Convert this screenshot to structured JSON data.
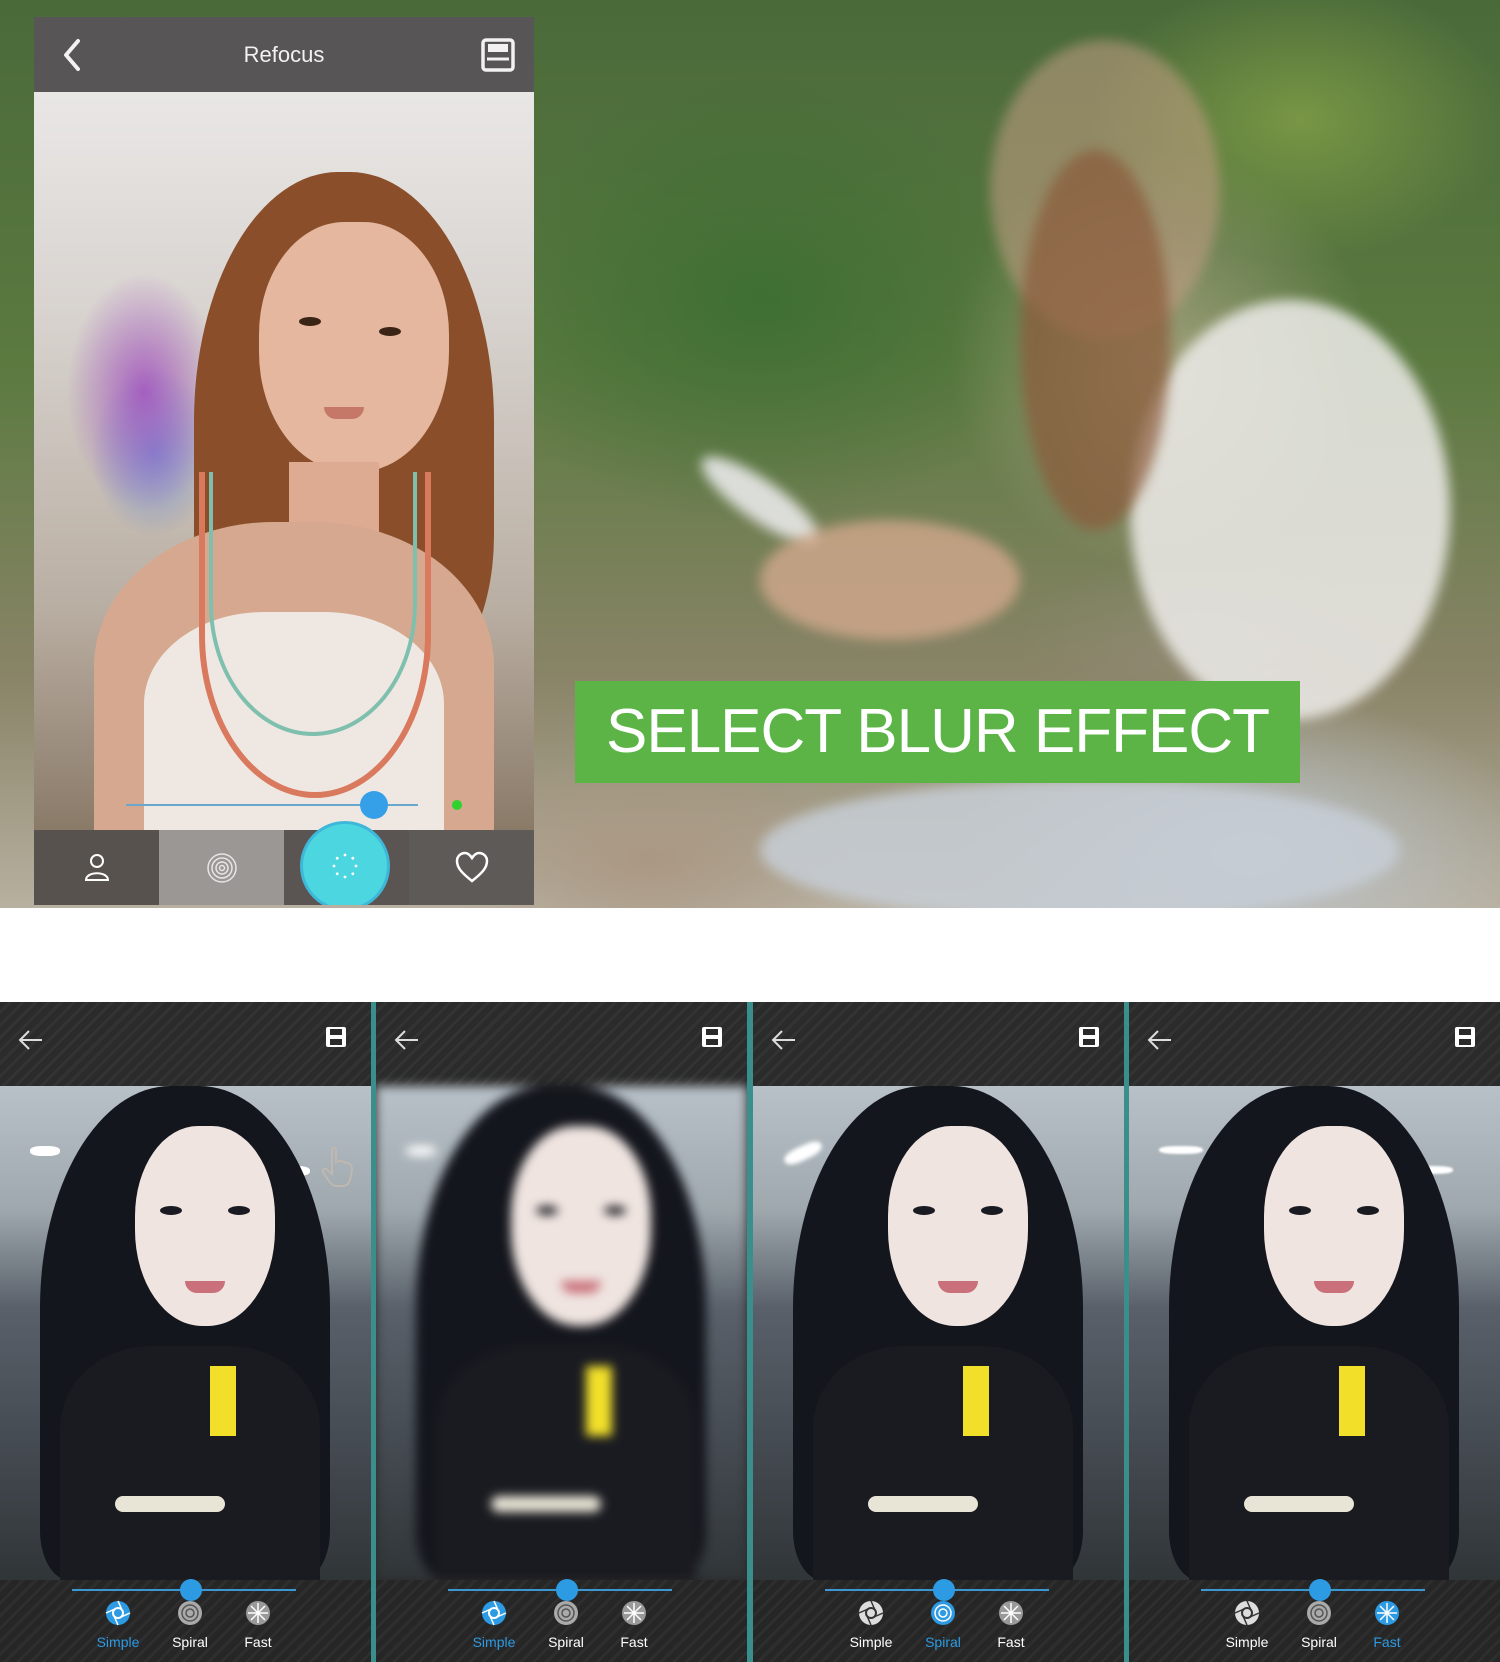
{
  "phone": {
    "title": "Refocus",
    "back_icon": "chevron-left-icon",
    "save_icon": "save-icon",
    "slider_value": 0.85,
    "toolbar": [
      "person-icon",
      "spiral-icon",
      "blur-mode-button",
      "heart-icon"
    ],
    "accent": "#4cd6e0"
  },
  "banner": {
    "text": "SELECT BLUR EFFECT",
    "color": "#5cb447"
  },
  "panels": [
    {
      "active": "Simple",
      "slider_value": 0.53
    },
    {
      "active": "Simple",
      "slider_value": 0.53
    },
    {
      "active": "Spiral",
      "slider_value": 0.53
    },
    {
      "active": "Fast",
      "slider_value": 0.53
    }
  ],
  "options": {
    "simple": "Simple",
    "spiral": "Spiral",
    "fast": "Fast"
  },
  "colors": {
    "active_blue": "#2d9be4",
    "divider": "#3a8f8c"
  }
}
